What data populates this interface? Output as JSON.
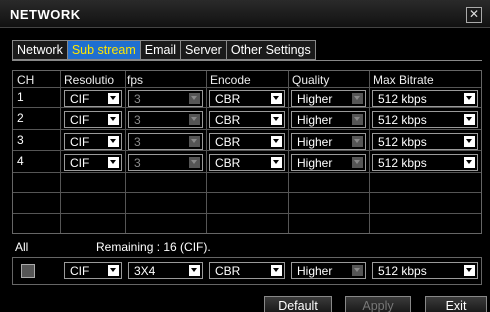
{
  "window": {
    "title": "NETWORK",
    "close_symbol": "✕"
  },
  "tabs": [
    {
      "label": "Network",
      "active": false
    },
    {
      "label": "Sub stream",
      "active": true
    },
    {
      "label": "Email",
      "active": false
    },
    {
      "label": "Server",
      "active": false
    },
    {
      "label": "Other Settings",
      "active": false
    }
  ],
  "table": {
    "headers": {
      "ch": "CH",
      "resolution": "Resolutio",
      "fps": "fps",
      "encode": "Encode",
      "quality": "Quality",
      "bitrate": "Max Bitrate"
    },
    "rows": [
      {
        "ch": "1",
        "resolution": "CIF",
        "fps": "3",
        "encode": "CBR",
        "quality": "Higher",
        "bitrate": "512 kbps"
      },
      {
        "ch": "2",
        "resolution": "CIF",
        "fps": "3",
        "encode": "CBR",
        "quality": "Higher",
        "bitrate": "512 kbps"
      },
      {
        "ch": "3",
        "resolution": "CIF",
        "fps": "3",
        "encode": "CBR",
        "quality": "Higher",
        "bitrate": "512 kbps"
      },
      {
        "ch": "4",
        "resolution": "CIF",
        "fps": "3",
        "encode": "CBR",
        "quality": "Higher",
        "bitrate": "512 kbps"
      }
    ]
  },
  "all_section": {
    "label": "All",
    "remaining": "Remaining : 16 (CIF).",
    "resolution": "CIF",
    "fps": "3X4",
    "encode": "CBR",
    "quality": "Higher",
    "bitrate": "512 kbps"
  },
  "buttons": {
    "default": "Default",
    "apply": "Apply",
    "exit": "Exit"
  },
  "colors": {
    "active_tab_bg": "#1f6fd0",
    "active_tab_text": "#ffe600"
  }
}
